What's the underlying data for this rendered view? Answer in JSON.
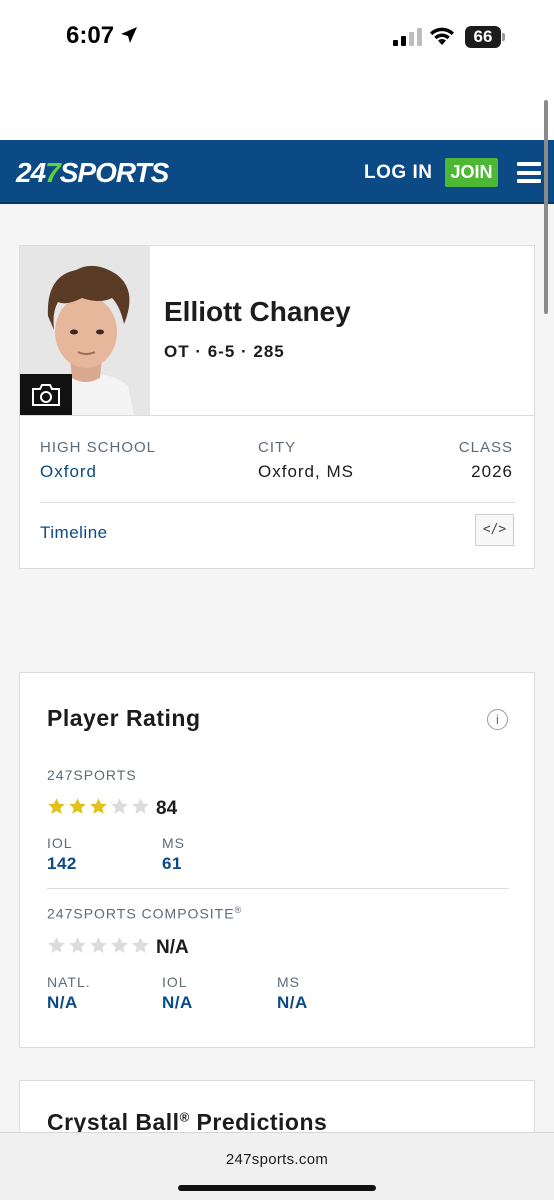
{
  "status_bar": {
    "time": "6:07",
    "battery": "66"
  },
  "nav": {
    "logo_prefix": "24",
    "logo_seven": "7",
    "logo_suffix": "SPORTS",
    "login_label": "LOG IN",
    "join_label": "JOIN",
    "accent_color": "#0b4a85",
    "join_color": "#4cb833"
  },
  "player": {
    "name": "Elliott Chaney",
    "meta": "OT · 6-5 · 285",
    "high_school_label": "HIGH SCHOOL",
    "high_school": "Oxford",
    "city_label": "CITY",
    "city": "Oxford, MS",
    "class_label": "CLASS",
    "class_year": "2026",
    "timeline_label": "Timeline",
    "embed_label": "</>",
    "photo_icon": "camera-icon"
  },
  "rating": {
    "title": "Player Rating",
    "info_label": "i",
    "sports247": {
      "label": "247SPORTS",
      "stars": 3,
      "stars_max": 5,
      "score": "84",
      "ranks": [
        {
          "label": "IOL",
          "value": "142"
        },
        {
          "label": "MS",
          "value": "61"
        }
      ]
    },
    "composite": {
      "label": "247SPORTS COMPOSITE",
      "registered": "®",
      "stars": 0,
      "stars_max": 5,
      "score": "N/A",
      "ranks": [
        {
          "label": "NATL.",
          "value": "N/A"
        },
        {
          "label": "IOL",
          "value": "N/A"
        },
        {
          "label": "MS",
          "value": "N/A"
        }
      ]
    },
    "star_color": "#e2c21a",
    "star_empty_color": "#dcdcdc"
  },
  "crystal_ball": {
    "title": "Crystal Ball",
    "registered": "®",
    "title_suffix": " Predictions"
  },
  "browser": {
    "url": "247sports.com"
  }
}
